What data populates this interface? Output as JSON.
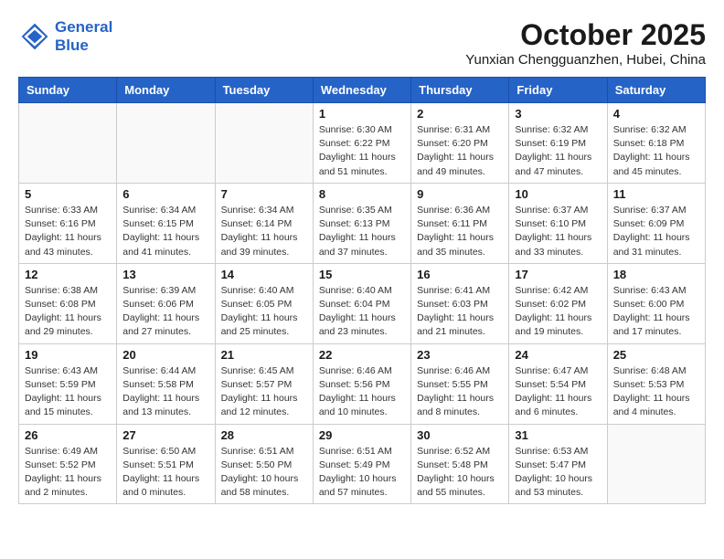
{
  "header": {
    "logo_line1": "General",
    "logo_line2": "Blue",
    "month_title": "October 2025",
    "location": "Yunxian Chengguanzhen, Hubei, China"
  },
  "days_of_week": [
    "Sunday",
    "Monday",
    "Tuesday",
    "Wednesday",
    "Thursday",
    "Friday",
    "Saturday"
  ],
  "weeks": [
    [
      {
        "day": "",
        "info": ""
      },
      {
        "day": "",
        "info": ""
      },
      {
        "day": "",
        "info": ""
      },
      {
        "day": "1",
        "info": "Sunrise: 6:30 AM\nSunset: 6:22 PM\nDaylight: 11 hours\nand 51 minutes."
      },
      {
        "day": "2",
        "info": "Sunrise: 6:31 AM\nSunset: 6:20 PM\nDaylight: 11 hours\nand 49 minutes."
      },
      {
        "day": "3",
        "info": "Sunrise: 6:32 AM\nSunset: 6:19 PM\nDaylight: 11 hours\nand 47 minutes."
      },
      {
        "day": "4",
        "info": "Sunrise: 6:32 AM\nSunset: 6:18 PM\nDaylight: 11 hours\nand 45 minutes."
      }
    ],
    [
      {
        "day": "5",
        "info": "Sunrise: 6:33 AM\nSunset: 6:16 PM\nDaylight: 11 hours\nand 43 minutes."
      },
      {
        "day": "6",
        "info": "Sunrise: 6:34 AM\nSunset: 6:15 PM\nDaylight: 11 hours\nand 41 minutes."
      },
      {
        "day": "7",
        "info": "Sunrise: 6:34 AM\nSunset: 6:14 PM\nDaylight: 11 hours\nand 39 minutes."
      },
      {
        "day": "8",
        "info": "Sunrise: 6:35 AM\nSunset: 6:13 PM\nDaylight: 11 hours\nand 37 minutes."
      },
      {
        "day": "9",
        "info": "Sunrise: 6:36 AM\nSunset: 6:11 PM\nDaylight: 11 hours\nand 35 minutes."
      },
      {
        "day": "10",
        "info": "Sunrise: 6:37 AM\nSunset: 6:10 PM\nDaylight: 11 hours\nand 33 minutes."
      },
      {
        "day": "11",
        "info": "Sunrise: 6:37 AM\nSunset: 6:09 PM\nDaylight: 11 hours\nand 31 minutes."
      }
    ],
    [
      {
        "day": "12",
        "info": "Sunrise: 6:38 AM\nSunset: 6:08 PM\nDaylight: 11 hours\nand 29 minutes."
      },
      {
        "day": "13",
        "info": "Sunrise: 6:39 AM\nSunset: 6:06 PM\nDaylight: 11 hours\nand 27 minutes."
      },
      {
        "day": "14",
        "info": "Sunrise: 6:40 AM\nSunset: 6:05 PM\nDaylight: 11 hours\nand 25 minutes."
      },
      {
        "day": "15",
        "info": "Sunrise: 6:40 AM\nSunset: 6:04 PM\nDaylight: 11 hours\nand 23 minutes."
      },
      {
        "day": "16",
        "info": "Sunrise: 6:41 AM\nSunset: 6:03 PM\nDaylight: 11 hours\nand 21 minutes."
      },
      {
        "day": "17",
        "info": "Sunrise: 6:42 AM\nSunset: 6:02 PM\nDaylight: 11 hours\nand 19 minutes."
      },
      {
        "day": "18",
        "info": "Sunrise: 6:43 AM\nSunset: 6:00 PM\nDaylight: 11 hours\nand 17 minutes."
      }
    ],
    [
      {
        "day": "19",
        "info": "Sunrise: 6:43 AM\nSunset: 5:59 PM\nDaylight: 11 hours\nand 15 minutes."
      },
      {
        "day": "20",
        "info": "Sunrise: 6:44 AM\nSunset: 5:58 PM\nDaylight: 11 hours\nand 13 minutes."
      },
      {
        "day": "21",
        "info": "Sunrise: 6:45 AM\nSunset: 5:57 PM\nDaylight: 11 hours\nand 12 minutes."
      },
      {
        "day": "22",
        "info": "Sunrise: 6:46 AM\nSunset: 5:56 PM\nDaylight: 11 hours\nand 10 minutes."
      },
      {
        "day": "23",
        "info": "Sunrise: 6:46 AM\nSunset: 5:55 PM\nDaylight: 11 hours\nand 8 minutes."
      },
      {
        "day": "24",
        "info": "Sunrise: 6:47 AM\nSunset: 5:54 PM\nDaylight: 11 hours\nand 6 minutes."
      },
      {
        "day": "25",
        "info": "Sunrise: 6:48 AM\nSunset: 5:53 PM\nDaylight: 11 hours\nand 4 minutes."
      }
    ],
    [
      {
        "day": "26",
        "info": "Sunrise: 6:49 AM\nSunset: 5:52 PM\nDaylight: 11 hours\nand 2 minutes."
      },
      {
        "day": "27",
        "info": "Sunrise: 6:50 AM\nSunset: 5:51 PM\nDaylight: 11 hours\nand 0 minutes."
      },
      {
        "day": "28",
        "info": "Sunrise: 6:51 AM\nSunset: 5:50 PM\nDaylight: 10 hours\nand 58 minutes."
      },
      {
        "day": "29",
        "info": "Sunrise: 6:51 AM\nSunset: 5:49 PM\nDaylight: 10 hours\nand 57 minutes."
      },
      {
        "day": "30",
        "info": "Sunrise: 6:52 AM\nSunset: 5:48 PM\nDaylight: 10 hours\nand 55 minutes."
      },
      {
        "day": "31",
        "info": "Sunrise: 6:53 AM\nSunset: 5:47 PM\nDaylight: 10 hours\nand 53 minutes."
      },
      {
        "day": "",
        "info": ""
      }
    ]
  ]
}
